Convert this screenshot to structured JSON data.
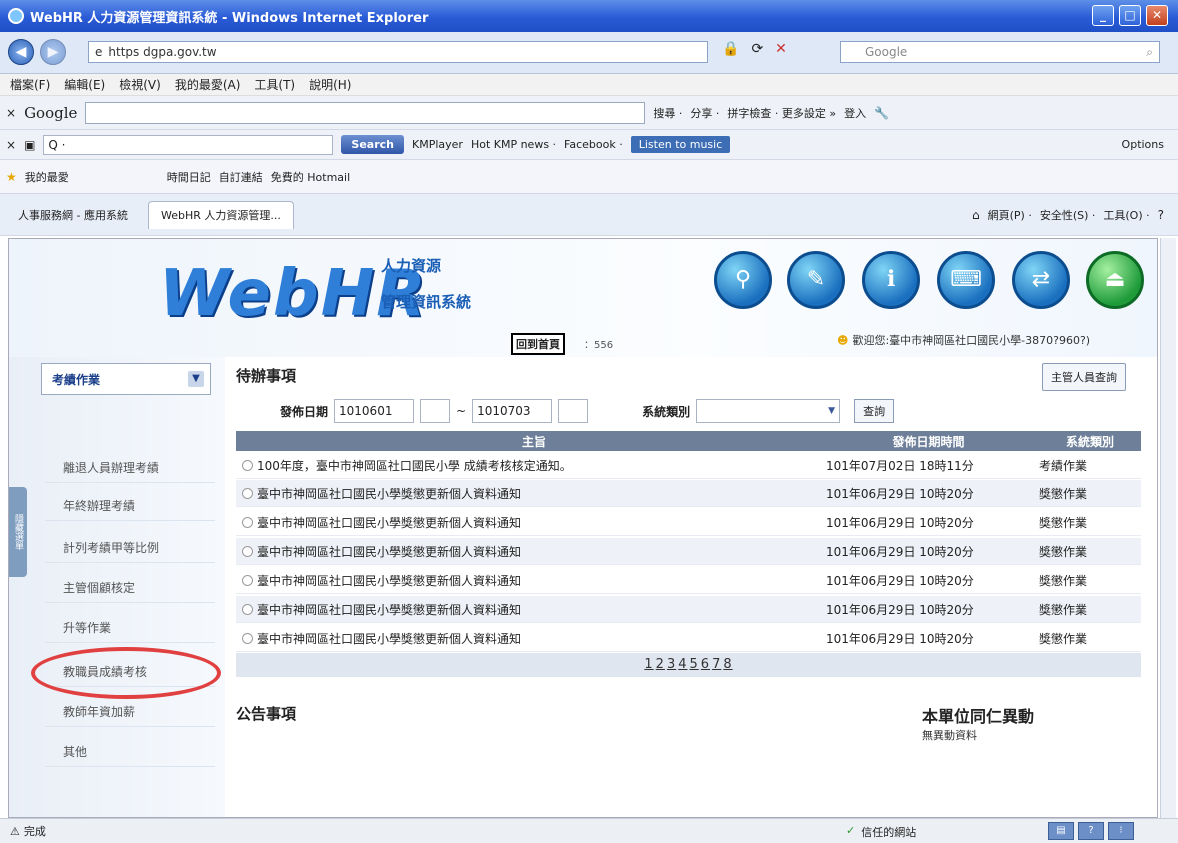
{
  "window": {
    "title": "WebHR 人力資源管理資訊系統 - Windows Internet Explorer",
    "min": "_",
    "max": "□",
    "close": "✕"
  },
  "address": {
    "url": "https dgpa.gov.tw",
    "search_placeholder": "Google"
  },
  "menubar": [
    "檔案(F)",
    "編輯(E)",
    "檢視(V)",
    "我的最愛(A)",
    "工具(T)",
    "說明(H)"
  ],
  "googlebar": {
    "logo": "Google",
    "items": [
      "搜尋 ·",
      "分享 ·",
      "拼字檢查 · 更多設定 »",
      "登入"
    ]
  },
  "kbar": {
    "search_value": "Q ·",
    "search_btn": "Search",
    "items": [
      "KMPlayer",
      "Hot KMP news ·",
      "Facebook ·"
    ],
    "listen": "Listen to music",
    "options": "Options"
  },
  "favbar": {
    "fav": "我的最愛",
    "items": [
      "時間日記",
      "自訂連結",
      "免費的 Hotmail"
    ]
  },
  "tabs": [
    {
      "label": "人事服務網 - 應用系統"
    },
    {
      "label": "WebHR 人力資源管理..."
    }
  ],
  "tabtools": [
    "網頁(P) ·",
    "安全性(S) ·",
    "工具(O) ·"
  ],
  "banner": {
    "logo": "WebHR",
    "sub1": "人力資源",
    "sub2": "管理資訊系統",
    "back_home": "回到首頁",
    "visit": "：556",
    "user": "歡迎您:臺中市神岡區社口國民小學-3870?960?)"
  },
  "sidebar": {
    "select": "考績作業",
    "items": [
      "離退人員辦理考績",
      "年終辦理考績",
      "計列考績甲等比例",
      "主管個顧核定",
      "升等作業",
      "教職員成績考核",
      "教師年資加薪",
      "其他"
    ],
    "sidetab": "隱藏選單"
  },
  "main": {
    "todo_title": "待辦事項",
    "manager_btn": "主管人員查詢",
    "filter": {
      "date_label": "發佈日期",
      "from": "1010601",
      "sep": "~",
      "to": "1010703",
      "type_label": "系統類別",
      "query": "查詢"
    },
    "columns": [
      "主旨",
      "發佈日期時間",
      "系統類別"
    ],
    "rows": [
      {
        "subject": "100年度，臺中市神岡區社口國民小學 成績考核核定通知。",
        "time": "101年07月02日 18時11分",
        "cat": "考績作業"
      },
      {
        "subject": "臺中市神岡區社口國民小學獎懲更新個人資料通知",
        "time": "101年06月29日 10時20分",
        "cat": "獎懲作業"
      },
      {
        "subject": "臺中市神岡區社口國民小學獎懲更新個人資料通知",
        "time": "101年06月29日 10時20分",
        "cat": "獎懲作業"
      },
      {
        "subject": "臺中市神岡區社口國民小學獎懲更新個人資料通知",
        "time": "101年06月29日 10時20分",
        "cat": "獎懲作業"
      },
      {
        "subject": "臺中市神岡區社口國民小學獎懲更新個人資料通知",
        "time": "101年06月29日 10時20分",
        "cat": "獎懲作業"
      },
      {
        "subject": "臺中市神岡區社口國民小學獎懲更新個人資料通知",
        "time": "101年06月29日 10時20分",
        "cat": "獎懲作業"
      },
      {
        "subject": "臺中市神岡區社口國民小學獎懲更新個人資料通知",
        "time": "101年06月29日 10時20分",
        "cat": "獎懲作業"
      }
    ],
    "pages": [
      "1",
      "2",
      "3",
      "4",
      "5",
      "6",
      "7",
      "8"
    ],
    "announce_title": "公告事項",
    "staff_title": "本單位同仁異動",
    "staff_none": "無異動資料"
  },
  "status": {
    "done": "完成",
    "trusted": "信任的網站"
  },
  "colors": {
    "title_bar": "#2a5bd6",
    "table_header": "#6e8099",
    "highlight_circle": "#e04040"
  }
}
